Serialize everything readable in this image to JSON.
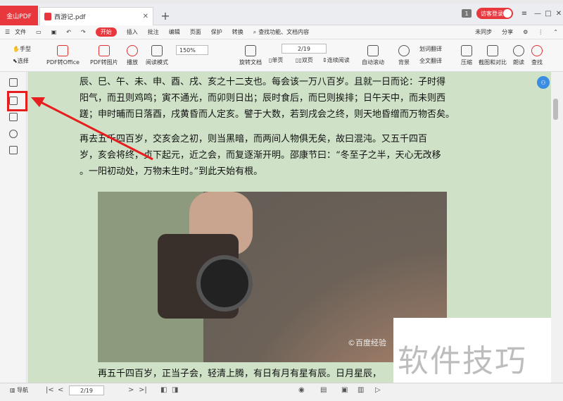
{
  "window": {
    "app_tab": "金山PDF",
    "doc_tab": "西游记.pdf",
    "badge": "1",
    "login": "访客登录"
  },
  "menu": {
    "file": "文件",
    "items": [
      "开始",
      "插入",
      "批注",
      "编辑",
      "页面",
      "保护",
      "转换"
    ],
    "search": "查找功能、文档内容",
    "sync": "未同步",
    "share": "分享"
  },
  "toolbar": {
    "hand": "手型",
    "select": "选择",
    "pdf_to_office": "PDF转Office",
    "pdf_to_image": "PDF转图片",
    "play": "播放",
    "read_mode": "阅读模式",
    "zoom": "150%",
    "rotate": "旋转文档",
    "page": "2/19",
    "single": "单页",
    "double": "双页",
    "continuous": "连续阅读",
    "auto_scroll": "自动滚动",
    "background": "背景",
    "word_translate": "划词翻译",
    "full_translate": "全文翻译",
    "compress": "压缩",
    "screenshot": "截图和对比",
    "read_aloud": "朗读",
    "find": "查找"
  },
  "content": {
    "para1": [
      "辰、巳、午、未、申、酉、戌、亥之十二支也。每会该一万八百岁。且就一日而论：子时得",
      "阳气，而丑则鸡鸣；寅不通光，而卯则日出；辰时食后，而巳则挨排；日午天中，而未则西",
      "蹉；申时晡而日落酉，戌黄昏而人定亥。譬于大数，若到戌会之终，则天地昏缯而万物否矣。"
    ],
    "para2": [
      "再去五千四百岁，交亥会之初，则当黑暗，而两间人物俱无矣，故曰混沌。又五千四百",
      "岁，亥会将终，贞下起元，近之会，而复逐渐开明。邵康节曰：“冬至子之半，天心无改移",
      "。一阳初动处，万物未生时。”到此天始有根。"
    ],
    "photo_watermark": "©百度经验",
    "last_line": "再五千四百岁，正当子会，轻清上腾，有日有月有星有辰。日月星辰，",
    "overlay": "软件技巧"
  },
  "status": {
    "nav": "导航",
    "page": "2/19"
  },
  "colors": {
    "accent": "#e8383d",
    "page_bg": "#cfe2c8",
    "highlight": "#e61e1e"
  }
}
